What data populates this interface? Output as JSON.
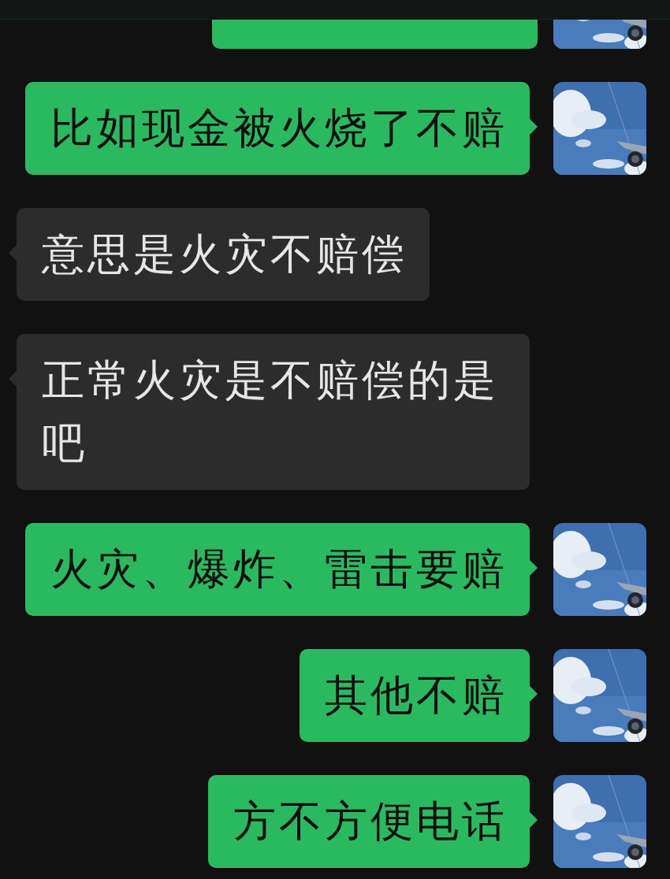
{
  "partial_message": {
    "kind": "outgoing"
  },
  "messages": [
    {
      "kind": "outgoing",
      "text": "比如现金被火烧了不赔"
    },
    {
      "kind": "incoming",
      "text": "意思是火灾不赔偿"
    },
    {
      "kind": "incoming",
      "text": "正常火灾是不赔偿的是吧"
    },
    {
      "kind": "outgoing",
      "text": "火灾、爆炸、雷击要赔"
    },
    {
      "kind": "outgoing",
      "text": "其他不赔"
    },
    {
      "kind": "outgoing",
      "text": "方不方便电话"
    }
  ]
}
